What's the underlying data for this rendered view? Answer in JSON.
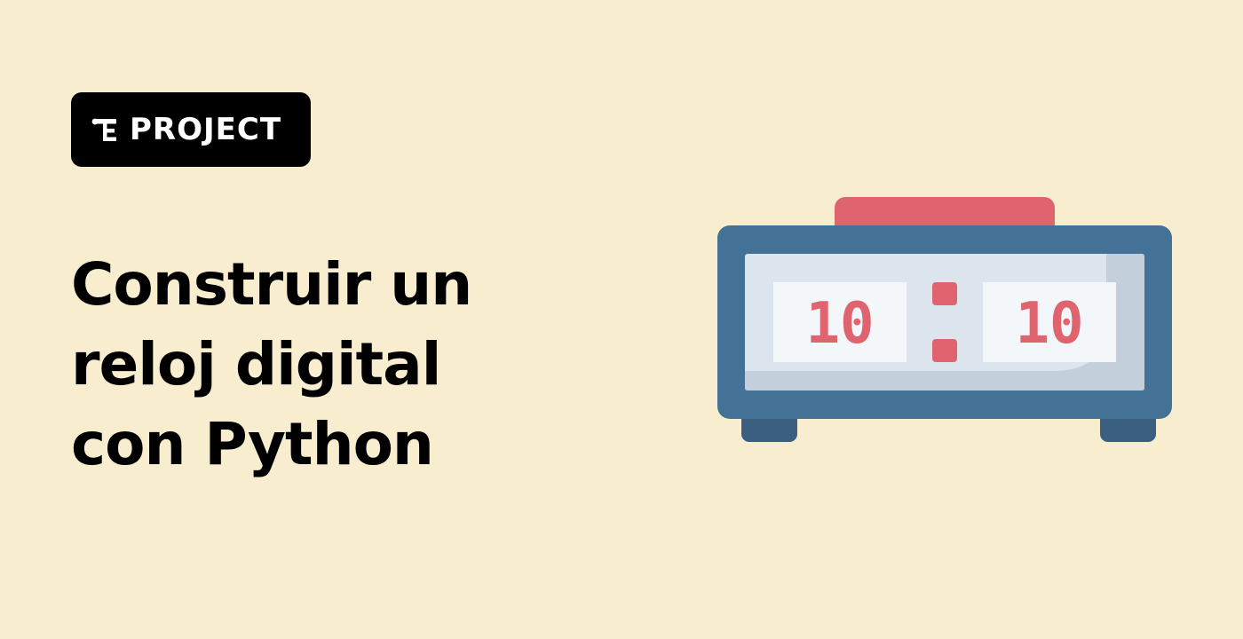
{
  "badge": {
    "icon": "project-tree-icon",
    "label": "PROJECT"
  },
  "title": {
    "line1": "Construir un",
    "line2": "reloj digital",
    "line3": "con Python"
  },
  "clock": {
    "icon": "alarm-clock-icon",
    "hours": "10",
    "minutes": "10"
  },
  "colors": {
    "background": "#f8edcf",
    "badge": "#000000",
    "clock_frame": "#447296",
    "clock_button": "#e06370",
    "clock_digits": "#e06370",
    "clock_screen": "#dce4ee"
  }
}
